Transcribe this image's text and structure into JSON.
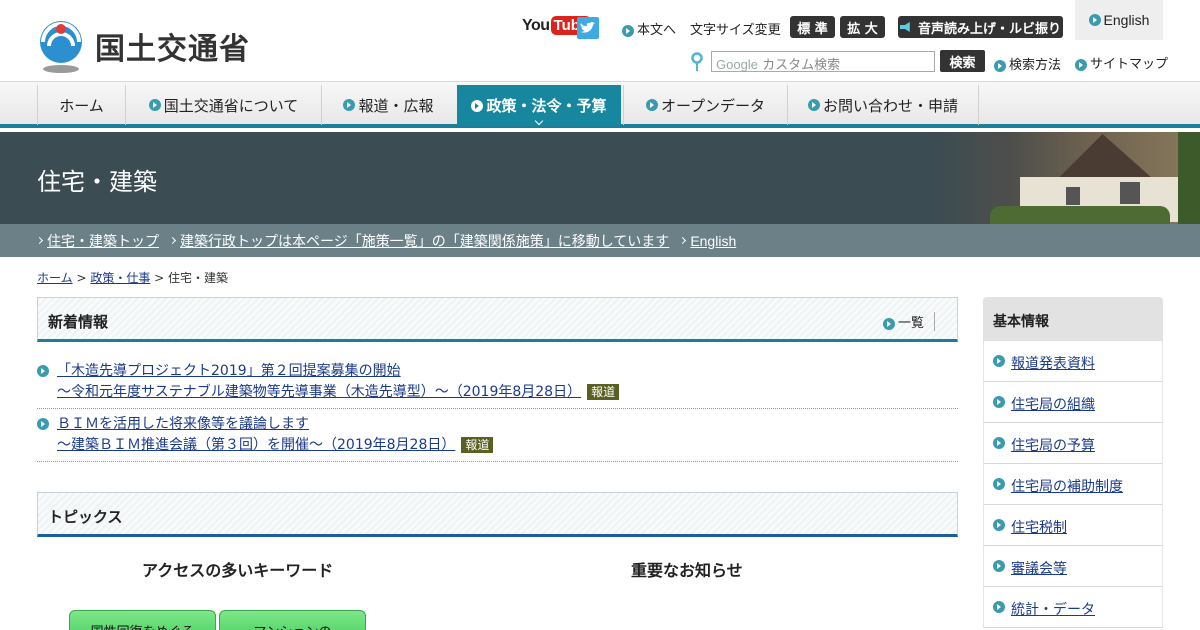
{
  "header": {
    "site_name": "国土交通省",
    "youtube_word": "You",
    "youtube_box": "Tube",
    "skip_label": "本文へ",
    "font_size_label": "文字サイズ変更",
    "font_std": "標 準",
    "font_large": "拡 大",
    "voice_label": "音声読み上げ・ルビ振り",
    "english_label": "English",
    "search_google": "Google",
    "search_placeholder": "カスタム検索",
    "search_button": "検索",
    "search_help": "検索方法",
    "sitemap": "サイトマップ"
  },
  "gnav": [
    {
      "label": "ホーム"
    },
    {
      "label": "国土交通省について"
    },
    {
      "label": "報道・広報"
    },
    {
      "label": "政策・法令・予算"
    },
    {
      "label": "オープンデータ"
    },
    {
      "label": "お問い合わせ・申請"
    }
  ],
  "banner": {
    "title": "住宅・建築"
  },
  "sublinks": [
    "住宅・建築トップ",
    "建築行政トップは本ページ「施策一覧」の「建築関係施策」に移動しています",
    "English"
  ],
  "breadcrumb": {
    "home": "ホーム",
    "sep1": " > ",
    "policy": "政策・仕事",
    "sep2": " > ",
    "current": "住宅・建築"
  },
  "news": {
    "title": "新着情報",
    "list_label": "一覧",
    "items": [
      {
        "line1": "「木造先導プロジェクト2019」第２回提案募集の開始",
        "line2": "～令和元年度サステナブル建築物等先導事業（木造先導型）～（2019年8月28日）",
        "badge": "報道"
      },
      {
        "line1": "ＢＩＭを活用した将来像等を議論します",
        "line2": "～建築ＢＩＭ推進会議（第３回）を開催～（2019年8月28日）",
        "badge": "報道"
      }
    ]
  },
  "topics": {
    "title": "トピックス",
    "col1_title": "アクセスの多いキーワード",
    "col2_title": "重要なお知らせ",
    "kw1": "国性回復をめぐる",
    "kw2": "マンションの"
  },
  "sidebar": {
    "title": "基本情報",
    "items": [
      "報道発表資料",
      "住宅局の組織",
      "住宅局の予算",
      "住宅局の補助制度",
      "住宅税制",
      "審議会等",
      "統計・データ"
    ]
  },
  "colors": {
    "accent": "#16879f",
    "banner": "#3b4c52",
    "subbar": "#6b8187",
    "badge": "#5a6020"
  }
}
